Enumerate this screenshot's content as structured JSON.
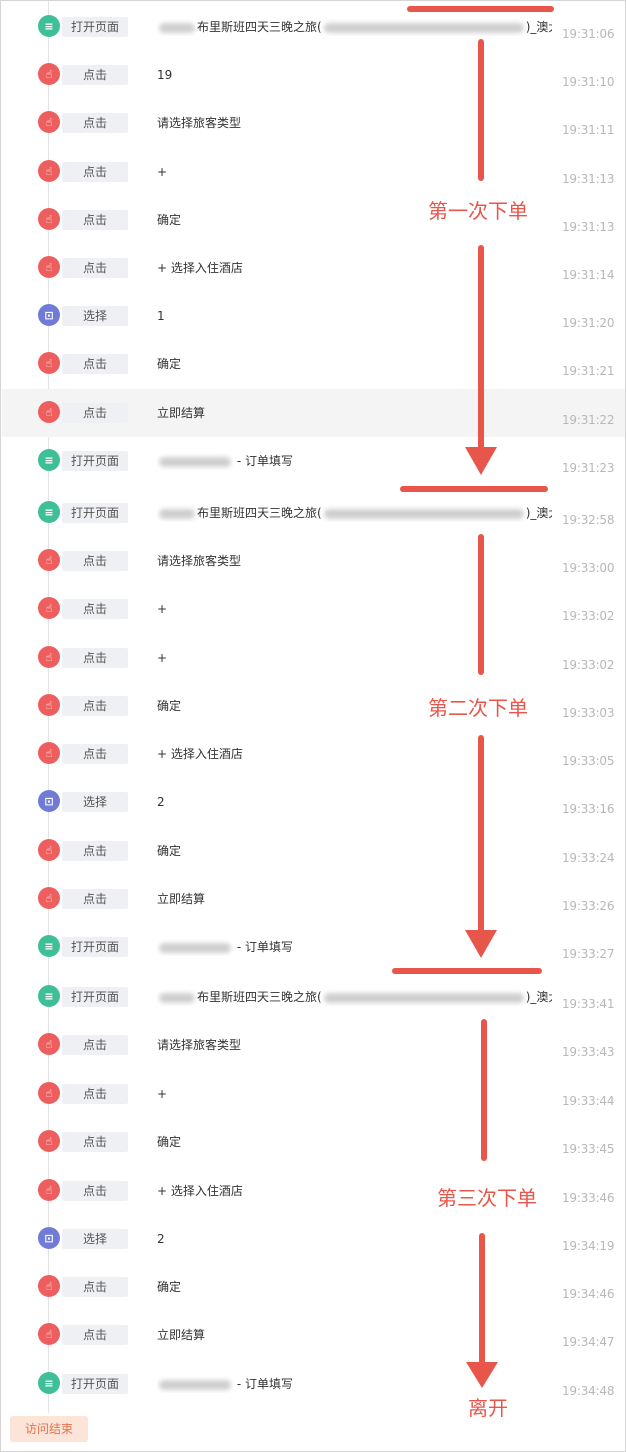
{
  "events": [
    {
      "type": "open",
      "tag": "打开页面",
      "text_pre": "布里斯班四天三晚之旅(",
      "text_post": ")_澳大…",
      "blur_pre": 36,
      "blur_mid": 200,
      "time": "19:31:06"
    },
    {
      "type": "click",
      "tag": "点击",
      "text": "19",
      "time": "19:31:10"
    },
    {
      "type": "click",
      "tag": "点击",
      "text": "请选择旅客类型",
      "time": "19:31:11"
    },
    {
      "type": "click",
      "tag": "点击",
      "text": "+",
      "time": "19:31:13"
    },
    {
      "type": "click",
      "tag": "点击",
      "text": "确定",
      "time": "19:31:13"
    },
    {
      "type": "click",
      "tag": "点击",
      "text": "+ 选择入住酒店",
      "time": "19:31:14"
    },
    {
      "type": "select",
      "tag": "选择",
      "text": "1",
      "time": "19:31:20"
    },
    {
      "type": "click",
      "tag": "点击",
      "text": "确定",
      "time": "19:31:21"
    },
    {
      "type": "click",
      "tag": "点击",
      "text": "立即结算",
      "time": "19:31:22",
      "highlight": true
    },
    {
      "type": "open",
      "tag": "打开页面",
      "text_post": " - 订单填写",
      "blur_pre": 72,
      "time": "19:31:23"
    },
    {
      "type": "open",
      "tag": "打开页面",
      "text_pre": "布里斯班四天三晚之旅(",
      "text_post": ")_澳大…",
      "blur_pre": 36,
      "blur_mid": 200,
      "time": "19:32:58"
    },
    {
      "type": "click",
      "tag": "点击",
      "text": "请选择旅客类型",
      "time": "19:33:00"
    },
    {
      "type": "click",
      "tag": "点击",
      "text": "+",
      "time": "19:33:02"
    },
    {
      "type": "click",
      "tag": "点击",
      "text": "+",
      "time": "19:33:02"
    },
    {
      "type": "click",
      "tag": "点击",
      "text": "确定",
      "time": "19:33:03"
    },
    {
      "type": "click",
      "tag": "点击",
      "text": "+ 选择入住酒店",
      "time": "19:33:05"
    },
    {
      "type": "select",
      "tag": "选择",
      "text": "2",
      "time": "19:33:16"
    },
    {
      "type": "click",
      "tag": "点击",
      "text": "确定",
      "time": "19:33:24"
    },
    {
      "type": "click",
      "tag": "点击",
      "text": "立即结算",
      "time": "19:33:26"
    },
    {
      "type": "open",
      "tag": "打开页面",
      "text_post": " - 订单填写",
      "blur_pre": 72,
      "time": "19:33:27"
    },
    {
      "type": "open",
      "tag": "打开页面",
      "text_pre": "布里斯班四天三晚之旅(",
      "text_post": ")_澳大…",
      "blur_pre": 36,
      "blur_mid": 200,
      "time": "19:33:41"
    },
    {
      "type": "click",
      "tag": "点击",
      "text": "请选择旅客类型",
      "time": "19:33:43"
    },
    {
      "type": "click",
      "tag": "点击",
      "text": "+",
      "time": "19:33:44"
    },
    {
      "type": "click",
      "tag": "点击",
      "text": "确定",
      "time": "19:33:45"
    },
    {
      "type": "click",
      "tag": "点击",
      "text": "+ 选择入住酒店",
      "time": "19:33:46"
    },
    {
      "type": "select",
      "tag": "选择",
      "text": "2",
      "time": "19:34:19"
    },
    {
      "type": "click",
      "tag": "点击",
      "text": "确定",
      "time": "19:34:46"
    },
    {
      "type": "click",
      "tag": "点击",
      "text": "立即结算",
      "time": "19:34:47"
    },
    {
      "type": "open",
      "tag": "打开页面",
      "text_post": " - 订单填写",
      "blur_pre": 72,
      "time": "19:34:48"
    }
  ],
  "end_badge": "访问结束",
  "annotations": {
    "first_order": "第一次下单",
    "second_order": "第二次下单",
    "third_order": "第三次下单",
    "leave": "离开"
  },
  "colors": {
    "annotation": "#e8564b",
    "open_icon": "#3fbf98",
    "click_icon": "#ee5e5e",
    "select_icon": "#6f7bd6"
  }
}
